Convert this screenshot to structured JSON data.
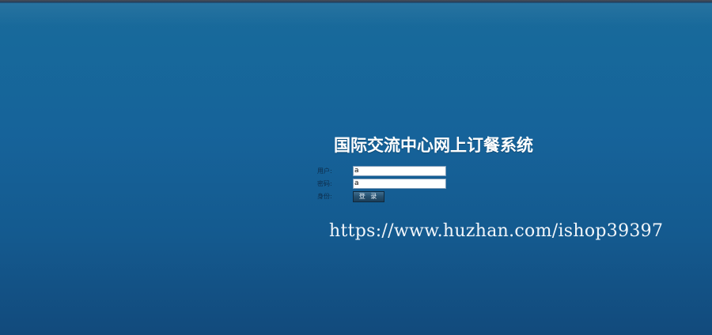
{
  "title": "国际交流中心网上订餐系统",
  "form": {
    "username_label": "用户:",
    "username_value": "a",
    "password_label": "密码:",
    "password_value": "a",
    "identity_label": "身份:",
    "login_button": "登 录"
  },
  "watermark": "https://www.huzhan.com/ishop39397"
}
